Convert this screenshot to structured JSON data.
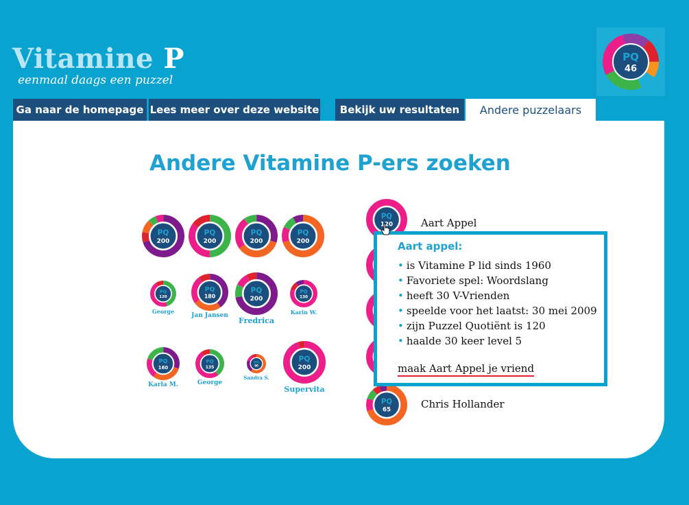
{
  "logo": {
    "title_part1": "Vitamine",
    "title_part2": "P",
    "tagline": "eenmaal daags een puzzel"
  },
  "header_badge": {
    "label": "PQ",
    "value": "46"
  },
  "nav": {
    "tabs": [
      {
        "label": "Ga naar de homepage"
      },
      {
        "label": "Lees meer over deze website"
      },
      {
        "label": "Bekijk uw resultaten"
      },
      {
        "label": "Andere puzzelaars",
        "active": true
      }
    ]
  },
  "page": {
    "title": "Andere Vitamine P-ers zoeken"
  },
  "grid_badges": [
    {
      "label": "PQ",
      "value": "200",
      "name": ""
    },
    {
      "label": "PQ",
      "value": "200",
      "name": ""
    },
    {
      "label": "PQ",
      "value": "200",
      "name": ""
    },
    {
      "label": "PQ",
      "value": "200",
      "name": ""
    },
    {
      "label": "PQ",
      "value": "120",
      "name": "George"
    },
    {
      "label": "PQ",
      "value": "180",
      "name": "Jan Jansen"
    },
    {
      "label": "PQ",
      "value": "200",
      "name": "Fredrica"
    },
    {
      "label": "PQ",
      "value": "130",
      "name": "Karin W."
    },
    {
      "label": "PQ",
      "value": "160",
      "name": "Karla M."
    },
    {
      "label": "PQ",
      "value": "135",
      "name": "George"
    },
    {
      "label": "PQ",
      "value": "90",
      "name": "Sandra S."
    },
    {
      "label": "PQ",
      "value": "200",
      "name": "Supervita"
    }
  ],
  "user_list": [
    {
      "label": "PQ",
      "value": "120",
      "name": "Aart Appel"
    },
    {
      "label": "PQ",
      "value": "65",
      "name": "Chris Hollander"
    }
  ],
  "popup": {
    "title": "Aart appel:",
    "items": [
      "is Vitamine P lid sinds 1960",
      "Favoriete spel: Woordslang",
      "heeft 30 V-Vrienden",
      "speelde voor het laatst: 30 mei 2009",
      "zijn Puzzel Quotiënt is 120",
      "haalde 30 keer level 5"
    ],
    "link": "maak Aart Appel je vriend"
  },
  "colors": {
    "background": "#0aa3cf",
    "nav": "#1d4f7c",
    "accent": "#1fa2cf",
    "pink": "#ec1f8a",
    "purple": "#7d1a8c",
    "green": "#3cb44a",
    "orange": "#f26522",
    "red": "#e0222e",
    "center": "#1b4d7d"
  }
}
